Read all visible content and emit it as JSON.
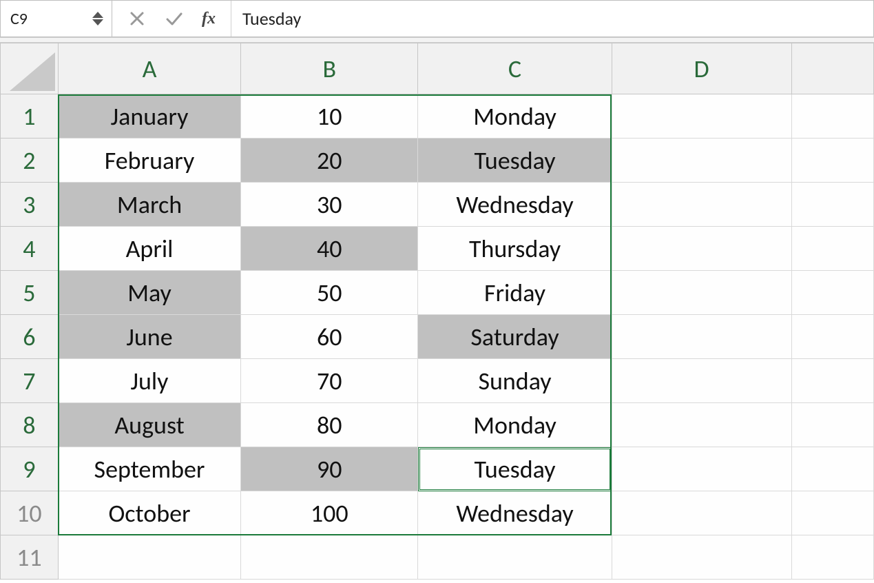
{
  "name_box": "C9",
  "formula": "Tuesday",
  "columns": [
    "A",
    "B",
    "C",
    "D"
  ],
  "rows": [
    "1",
    "2",
    "3",
    "4",
    "5",
    "6",
    "7",
    "8",
    "9",
    "10",
    "11"
  ],
  "cells": {
    "A": [
      "January",
      "February",
      "March",
      "April",
      "May",
      "June",
      "July",
      "August",
      "September",
      "October",
      ""
    ],
    "B": [
      "10",
      "20",
      "30",
      "40",
      "50",
      "60",
      "70",
      "80",
      "90",
      "100",
      ""
    ],
    "C": [
      "Monday",
      "Tuesday",
      "Wednesday",
      "Thursday",
      "Friday",
      "Saturday",
      "Sunday",
      "Monday",
      "Tuesday",
      "Wednesday",
      ""
    ],
    "D": [
      "",
      "",
      "",
      "",
      "",
      "",
      "",
      "",
      "",
      "",
      ""
    ]
  },
  "shaded": [
    "A1",
    "B2",
    "C2",
    "A3",
    "B4",
    "A5",
    "A6",
    "C6",
    "A8",
    "B9"
  ],
  "selection_range": "A1:C10",
  "active_cell": "C9"
}
